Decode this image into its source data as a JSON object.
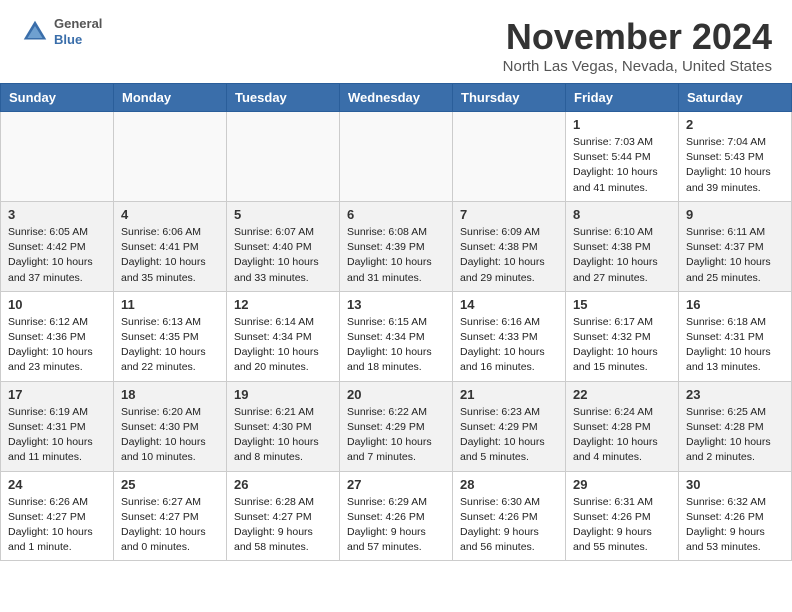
{
  "header": {
    "logo": {
      "general": "General",
      "blue": "Blue"
    },
    "month": "November 2024",
    "location": "North Las Vegas, Nevada, United States"
  },
  "weekdays": [
    "Sunday",
    "Monday",
    "Tuesday",
    "Wednesday",
    "Thursday",
    "Friday",
    "Saturday"
  ],
  "weeks": [
    [
      {
        "day": "",
        "info": ""
      },
      {
        "day": "",
        "info": ""
      },
      {
        "day": "",
        "info": ""
      },
      {
        "day": "",
        "info": ""
      },
      {
        "day": "",
        "info": ""
      },
      {
        "day": "1",
        "info": "Sunrise: 7:03 AM\nSunset: 5:44 PM\nDaylight: 10 hours\nand 41 minutes."
      },
      {
        "day": "2",
        "info": "Sunrise: 7:04 AM\nSunset: 5:43 PM\nDaylight: 10 hours\nand 39 minutes."
      }
    ],
    [
      {
        "day": "3",
        "info": "Sunrise: 6:05 AM\nSunset: 4:42 PM\nDaylight: 10 hours\nand 37 minutes."
      },
      {
        "day": "4",
        "info": "Sunrise: 6:06 AM\nSunset: 4:41 PM\nDaylight: 10 hours\nand 35 minutes."
      },
      {
        "day": "5",
        "info": "Sunrise: 6:07 AM\nSunset: 4:40 PM\nDaylight: 10 hours\nand 33 minutes."
      },
      {
        "day": "6",
        "info": "Sunrise: 6:08 AM\nSunset: 4:39 PM\nDaylight: 10 hours\nand 31 minutes."
      },
      {
        "day": "7",
        "info": "Sunrise: 6:09 AM\nSunset: 4:38 PM\nDaylight: 10 hours\nand 29 minutes."
      },
      {
        "day": "8",
        "info": "Sunrise: 6:10 AM\nSunset: 4:38 PM\nDaylight: 10 hours\nand 27 minutes."
      },
      {
        "day": "9",
        "info": "Sunrise: 6:11 AM\nSunset: 4:37 PM\nDaylight: 10 hours\nand 25 minutes."
      }
    ],
    [
      {
        "day": "10",
        "info": "Sunrise: 6:12 AM\nSunset: 4:36 PM\nDaylight: 10 hours\nand 23 minutes."
      },
      {
        "day": "11",
        "info": "Sunrise: 6:13 AM\nSunset: 4:35 PM\nDaylight: 10 hours\nand 22 minutes."
      },
      {
        "day": "12",
        "info": "Sunrise: 6:14 AM\nSunset: 4:34 PM\nDaylight: 10 hours\nand 20 minutes."
      },
      {
        "day": "13",
        "info": "Sunrise: 6:15 AM\nSunset: 4:34 PM\nDaylight: 10 hours\nand 18 minutes."
      },
      {
        "day": "14",
        "info": "Sunrise: 6:16 AM\nSunset: 4:33 PM\nDaylight: 10 hours\nand 16 minutes."
      },
      {
        "day": "15",
        "info": "Sunrise: 6:17 AM\nSunset: 4:32 PM\nDaylight: 10 hours\nand 15 minutes."
      },
      {
        "day": "16",
        "info": "Sunrise: 6:18 AM\nSunset: 4:31 PM\nDaylight: 10 hours\nand 13 minutes."
      }
    ],
    [
      {
        "day": "17",
        "info": "Sunrise: 6:19 AM\nSunset: 4:31 PM\nDaylight: 10 hours\nand 11 minutes."
      },
      {
        "day": "18",
        "info": "Sunrise: 6:20 AM\nSunset: 4:30 PM\nDaylight: 10 hours\nand 10 minutes."
      },
      {
        "day": "19",
        "info": "Sunrise: 6:21 AM\nSunset: 4:30 PM\nDaylight: 10 hours\nand 8 minutes."
      },
      {
        "day": "20",
        "info": "Sunrise: 6:22 AM\nSunset: 4:29 PM\nDaylight: 10 hours\nand 7 minutes."
      },
      {
        "day": "21",
        "info": "Sunrise: 6:23 AM\nSunset: 4:29 PM\nDaylight: 10 hours\nand 5 minutes."
      },
      {
        "day": "22",
        "info": "Sunrise: 6:24 AM\nSunset: 4:28 PM\nDaylight: 10 hours\nand 4 minutes."
      },
      {
        "day": "23",
        "info": "Sunrise: 6:25 AM\nSunset: 4:28 PM\nDaylight: 10 hours\nand 2 minutes."
      }
    ],
    [
      {
        "day": "24",
        "info": "Sunrise: 6:26 AM\nSunset: 4:27 PM\nDaylight: 10 hours\nand 1 minute."
      },
      {
        "day": "25",
        "info": "Sunrise: 6:27 AM\nSunset: 4:27 PM\nDaylight: 10 hours\nand 0 minutes."
      },
      {
        "day": "26",
        "info": "Sunrise: 6:28 AM\nSunset: 4:27 PM\nDaylight: 9 hours\nand 58 minutes."
      },
      {
        "day": "27",
        "info": "Sunrise: 6:29 AM\nSunset: 4:26 PM\nDaylight: 9 hours\nand 57 minutes."
      },
      {
        "day": "28",
        "info": "Sunrise: 6:30 AM\nSunset: 4:26 PM\nDaylight: 9 hours\nand 56 minutes."
      },
      {
        "day": "29",
        "info": "Sunrise: 6:31 AM\nSunset: 4:26 PM\nDaylight: 9 hours\nand 55 minutes."
      },
      {
        "day": "30",
        "info": "Sunrise: 6:32 AM\nSunset: 4:26 PM\nDaylight: 9 hours\nand 53 minutes."
      }
    ]
  ]
}
